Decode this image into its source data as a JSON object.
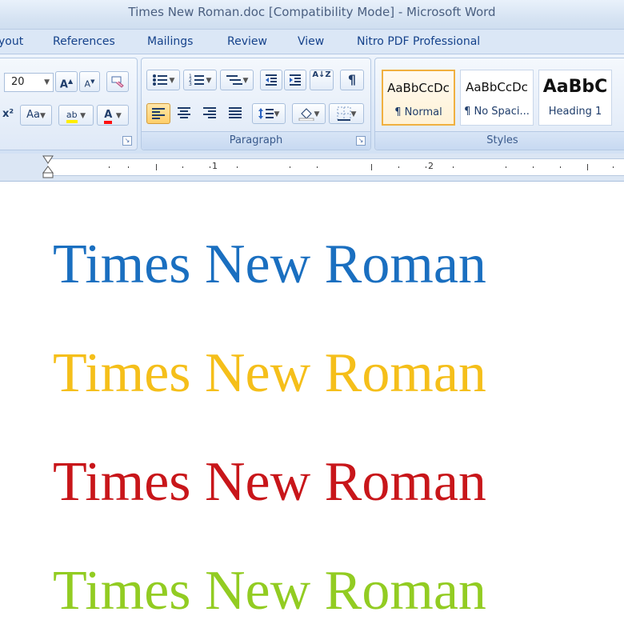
{
  "window": {
    "title": "Times New Roman.doc [Compatibility Mode] - Microsoft Word"
  },
  "tabs": [
    "yout",
    "References",
    "Mailings",
    "Review",
    "View",
    "Nitro PDF Professional"
  ],
  "font_group": {
    "font_size": "20",
    "grow_label": "A",
    "shrink_label": "A",
    "superscript_label": "x²",
    "change_case_label": "Aa",
    "highlight_label": "ab",
    "font_color_label": "A"
  },
  "paragraph_group": {
    "label": "Paragraph",
    "show_marks_label": "¶",
    "sort_label": "A↓Z"
  },
  "styles_group": {
    "label": "Styles",
    "items": [
      {
        "sample": "AaBbCcDc",
        "name": "¶ Normal",
        "selected": true
      },
      {
        "sample": "AaBbCcDc",
        "name": "¶ No Spaci...",
        "selected": false
      },
      {
        "sample": "AaBbC",
        "name": "Heading 1",
        "selected": false
      }
    ]
  },
  "ruler": {
    "marks": [
      "1",
      "2"
    ]
  },
  "document": {
    "lines": [
      {
        "text": "Times New Roman",
        "color": "#1a6fc0"
      },
      {
        "text": "Times New Roman",
        "color": "#f5bf1a"
      },
      {
        "text": "Times New Roman",
        "color": "#c8161a"
      },
      {
        "text": "Times New Roman",
        "color": "#92cc22"
      }
    ]
  }
}
